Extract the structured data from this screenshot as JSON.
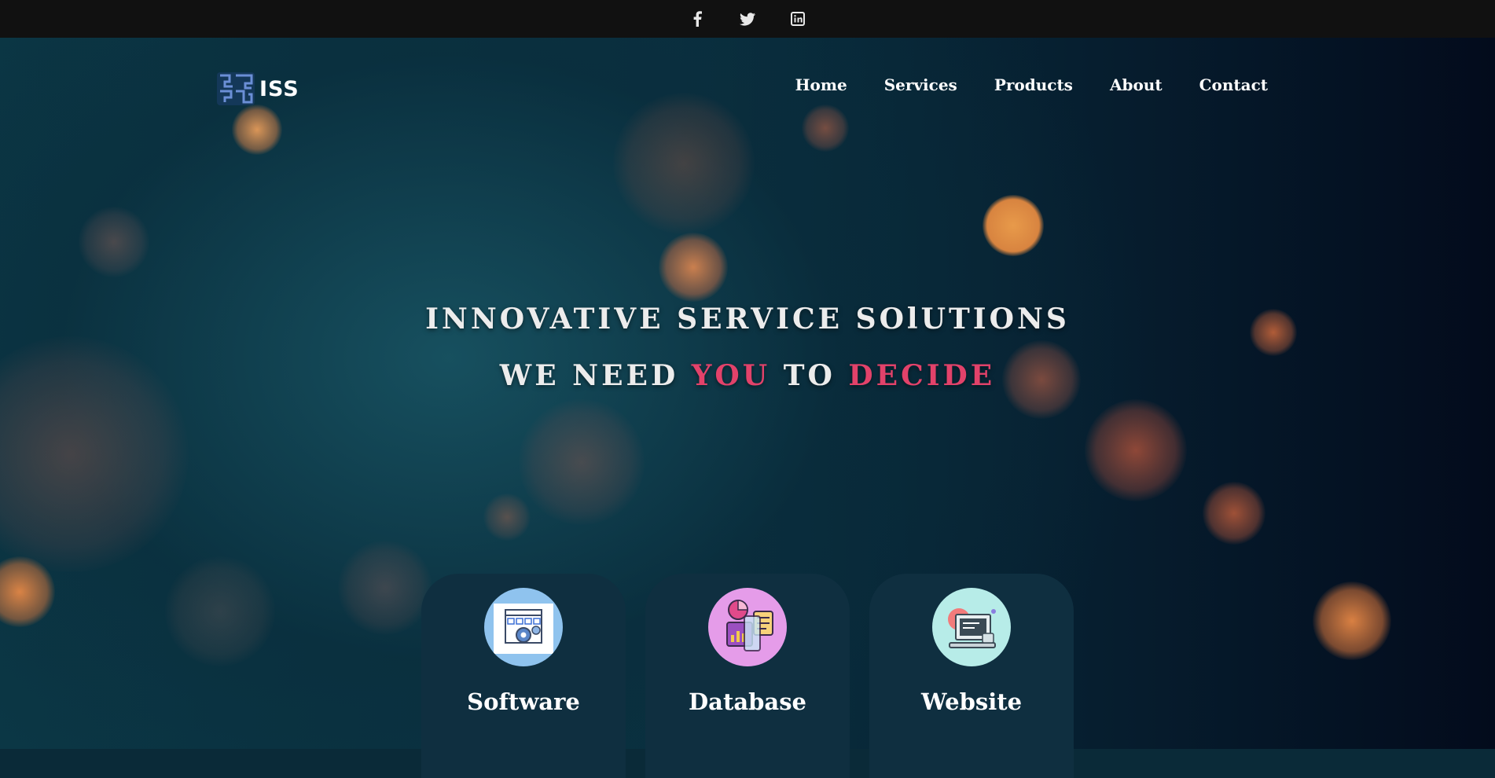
{
  "social": [
    {
      "name": "facebook",
      "glyph": "f"
    },
    {
      "name": "twitter",
      "glyph": "t"
    },
    {
      "name": "linkedin",
      "glyph": "in"
    }
  ],
  "brand": {
    "name": "ISS"
  },
  "nav": {
    "items": [
      "Home",
      "Services",
      "Products",
      "About",
      "Contact"
    ]
  },
  "hero": {
    "headline": "INNOVATIVE SERVICE SOlUTIONS",
    "tagline": {
      "part1": "WE NEED ",
      "accent1": "YOU",
      "part2": " TO ",
      "accent2": "DECIDE"
    }
  },
  "services": [
    {
      "title": "Software",
      "icon": "software-gear-window-icon",
      "icon_bg": "#8fc3ee"
    },
    {
      "title": "Database",
      "icon": "database-dashboard-icon",
      "icon_bg": "#e59ce9"
    },
    {
      "title": "Website",
      "icon": "website-computer-icon",
      "icon_bg": "#b7ece8"
    }
  ],
  "colors": {
    "accent": "#e2426a",
    "topbar": "#111111",
    "card": "#0f2f40"
  }
}
